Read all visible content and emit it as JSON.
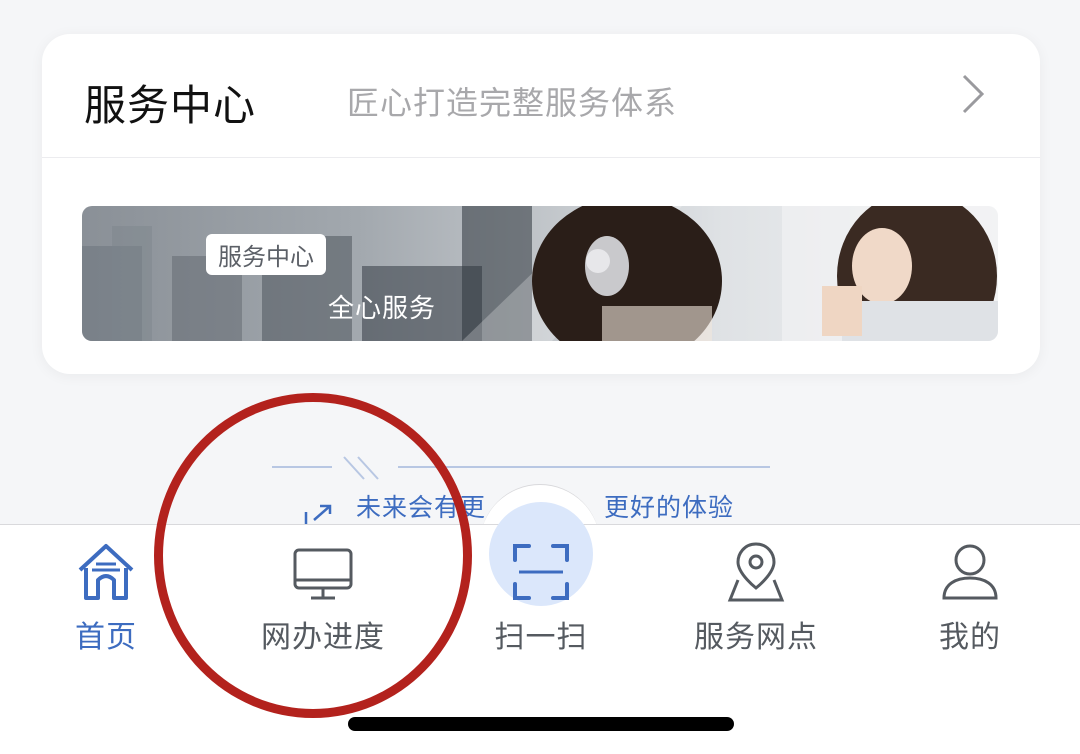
{
  "service_card": {
    "title": "服务中心",
    "subtitle": "匠心打造完整服务体系",
    "chevron_icon": "chevron-right-icon",
    "banner": {
      "tag": "服务中心",
      "text": "全心服务"
    }
  },
  "slogan": {
    "left_text": "未来会有更",
    "right_text": "更好的体验",
    "icon": "share-icon"
  },
  "tabbar": {
    "tabs": [
      {
        "label": "首页",
        "icon": "home-icon",
        "active": true
      },
      {
        "label": "网办进度",
        "icon": "monitor-icon",
        "active": false
      },
      {
        "label": "扫一扫",
        "icon": "scan-icon",
        "active": false
      },
      {
        "label": "服务网点",
        "icon": "map-pin-icon",
        "active": false
      },
      {
        "label": "我的",
        "icon": "user-icon",
        "active": false
      }
    ]
  },
  "colors": {
    "accent": "#3d6cc0",
    "inactive": "#555a60",
    "annotation": "#b3221d",
    "scan_bg": "#dbe7fb"
  }
}
